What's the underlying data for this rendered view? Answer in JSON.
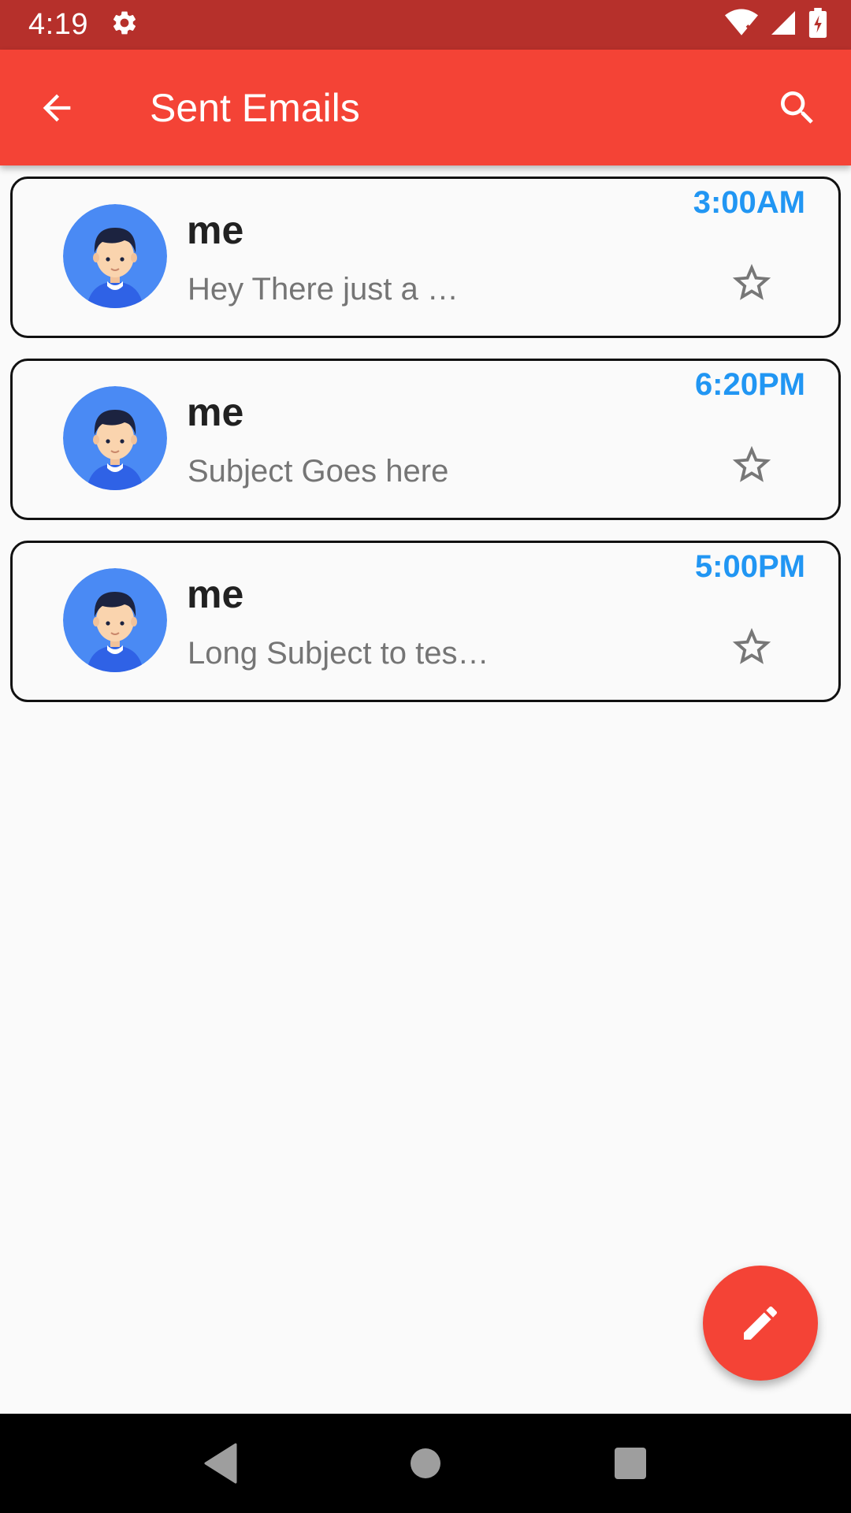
{
  "status_bar": {
    "time": "4:19",
    "icons": [
      "settings-icon",
      "wifi-icon",
      "signal-icon",
      "battery-icon"
    ]
  },
  "app_bar": {
    "title": "Sent Emails",
    "back_icon": "arrow-back-icon",
    "search_icon": "search-icon"
  },
  "emails": [
    {
      "sender": "me",
      "subject": "Hey There just a …",
      "time": "3:00AM",
      "starred": false
    },
    {
      "sender": "me",
      "subject": "Subject Goes here",
      "time": "6:20PM",
      "starred": false
    },
    {
      "sender": "me",
      "subject": "Long Subject to tes…",
      "time": "5:00PM",
      "starred": false
    }
  ],
  "fab": {
    "icon": "edit-icon"
  },
  "nav_bar": {
    "icons": [
      "back-triangle-icon",
      "home-circle-icon",
      "recents-square-icon"
    ]
  },
  "colors": {
    "status_bar": "#b6302b",
    "app_bar": "#f44336",
    "time_accent": "#2196f3",
    "fab": "#f44336",
    "background": "#fafafa"
  }
}
